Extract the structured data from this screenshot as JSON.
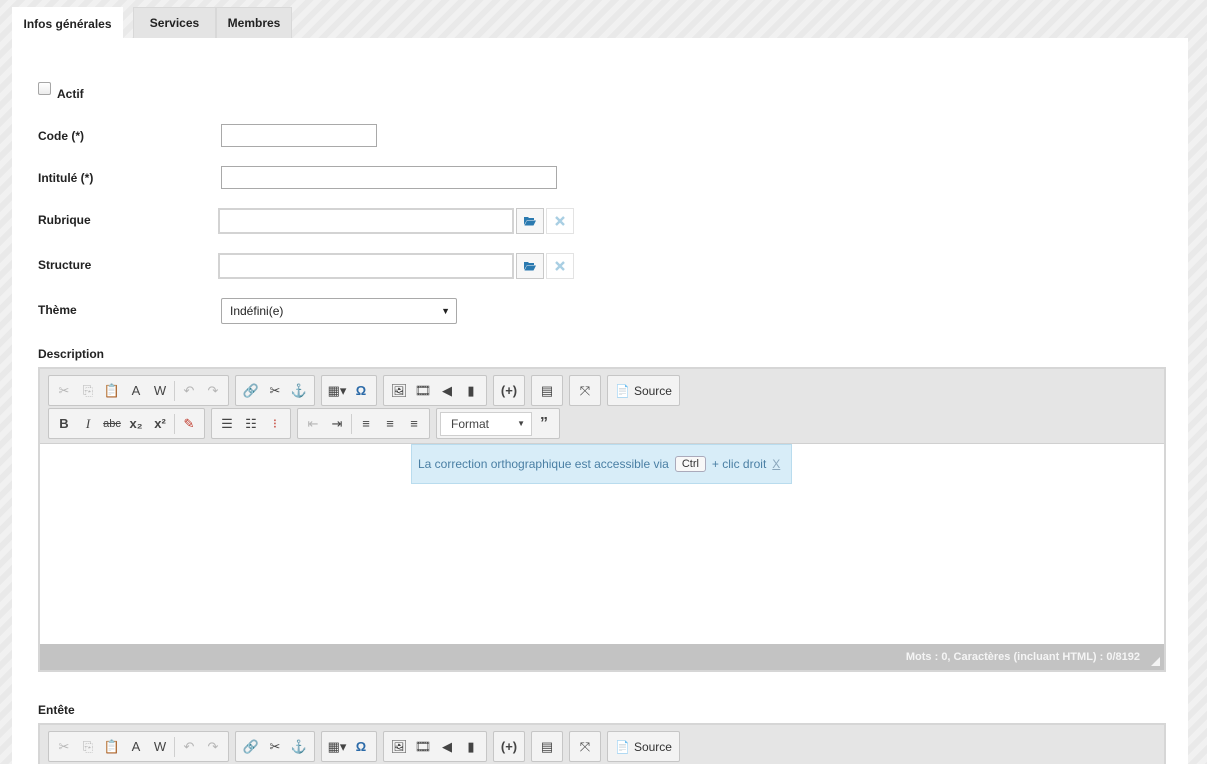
{
  "tabs": [
    {
      "label": "Infos générales",
      "active": true
    },
    {
      "label": "Services",
      "active": false
    },
    {
      "label": "Membres",
      "active": false
    }
  ],
  "form": {
    "actif_label": "Actif",
    "actif_checked": false,
    "code_label": "Code (*)",
    "code_value": "",
    "intitule_label": "Intitulé (*)",
    "intitule_value": "",
    "rubrique_label": "Rubrique",
    "rubrique_value": "",
    "structure_label": "Structure",
    "structure_value": "",
    "theme_label": "Thème",
    "theme_selected": "Indéfini(e)",
    "description_label": "Description",
    "entete_label": "Entête"
  },
  "editor": {
    "source_label": "Source",
    "format_label": "Format",
    "bold_label": "B",
    "italic_label": "I",
    "strike_label": "abc",
    "spell_tip_prefix": "La correction orthographique est accessible via",
    "spell_tip_key": "Ctrl",
    "spell_tip_suffix": "+ clic droit",
    "spell_tip_close": "X",
    "status_text": "Mots : 0, Caractères (incluant HTML) : 0/8192"
  },
  "colors": {
    "folder_icon": "#2b7ab0",
    "clear_icon": "#a9cfe3",
    "toolbar_bg": "#e5e5e5",
    "tip_bg": "#d8edf8"
  }
}
